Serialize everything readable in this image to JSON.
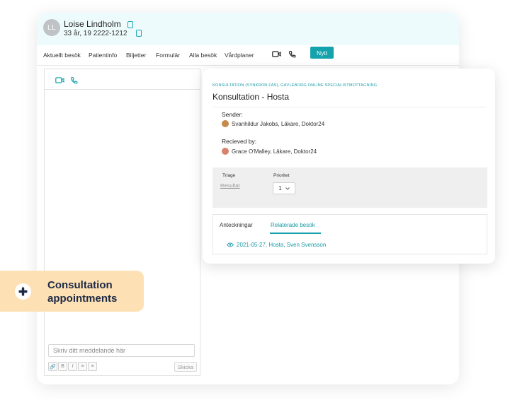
{
  "patient": {
    "initials": "LL",
    "name": "Loise Lindholm",
    "details": "33 år, 19 2222-1212"
  },
  "nav": {
    "items": [
      "Aktuellt besök",
      "Patientinfo",
      "Biljetter",
      "Formulär",
      "Alla besök",
      "Vårdplaner"
    ],
    "new_button": "Nytt"
  },
  "chat": {
    "placeholder": "Skriv ditt meddelande här",
    "format_buttons": [
      "🔗",
      "B",
      "I",
      "≡",
      "≡"
    ],
    "send_label": "Skicka"
  },
  "consultation": {
    "meta": "KONSULTATION (SYNKRON FAS), GÄVLEBORG ONLINE SPECIALISTMOTTAGNING",
    "title": "Konsultation - Hosta",
    "sender_label": "Sender:",
    "sender": "Svanhildur Jakobs, Läkare, Doktor24",
    "receiver_label": "Recieved by:",
    "receiver": "Grace O'Malley, Läkare, Doktor24",
    "triage_label": "Triage",
    "result_link": "Resultat",
    "priority_label": "Prioritet",
    "priority_value": "1",
    "tabs": [
      "Anteckningar",
      "Relaterade besök"
    ],
    "active_tab": "Relaterade besök",
    "related_visit": "2021-05-27, Hosta, Sven Svensson"
  },
  "promo": {
    "line1": "Consultation",
    "line2": "appointments"
  },
  "colors": {
    "accent": "#14a3ad",
    "header_bg": "#eefbfc",
    "promo_bg": "#fde0b4",
    "promo_text": "#1d2a45"
  }
}
